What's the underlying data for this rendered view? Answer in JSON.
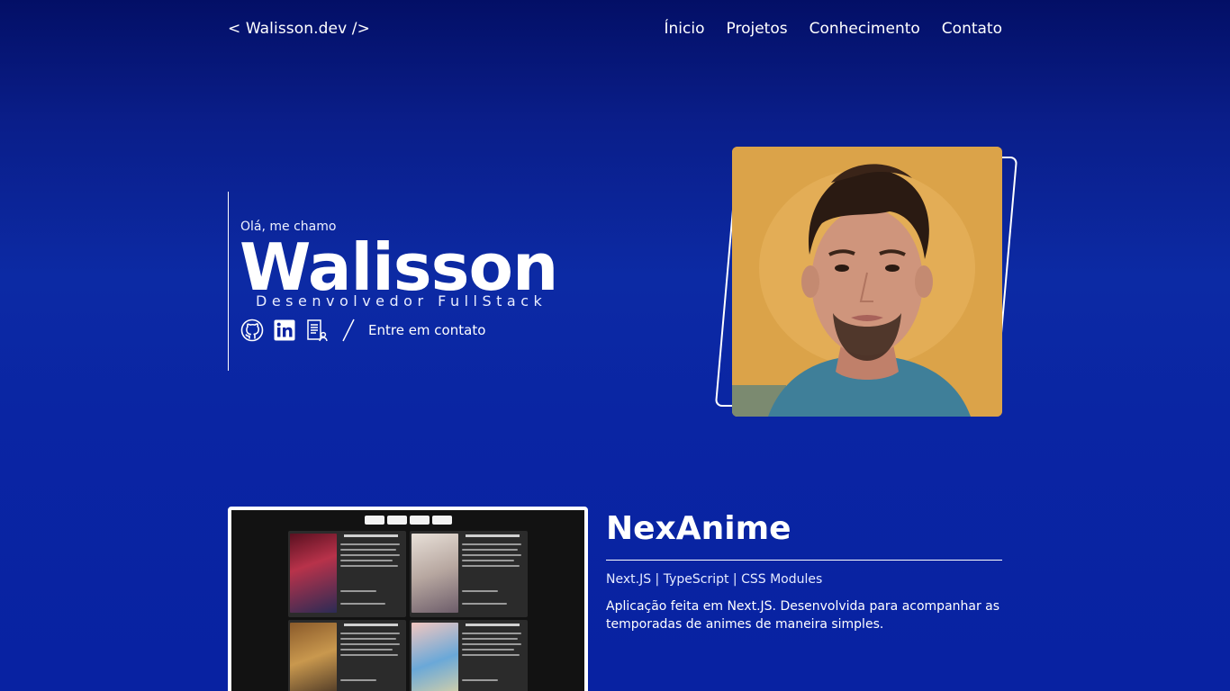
{
  "header": {
    "logo": "< Walisson.dev />",
    "nav": [
      "Ínicio",
      "Projetos",
      "Conhecimento",
      "Contato"
    ]
  },
  "hero": {
    "greeting": "Olá, me chamo",
    "name": "Walisson",
    "role": "Desenvolvedor FullStack",
    "contact_link": "Entre em contato",
    "socials": [
      "github-icon",
      "linkedin-icon",
      "resume-icon"
    ]
  },
  "project": {
    "title": "NexAnime",
    "stack": "Next.JS | TypeScript | CSS Modules",
    "description": "Aplicação feita em Next.JS. Desenvolvida para acompanhar as temporadas de animes de maneira simples."
  },
  "colors": {
    "background_top": "#030f66",
    "background": "#0c2aa4",
    "text": "#ffffff"
  }
}
